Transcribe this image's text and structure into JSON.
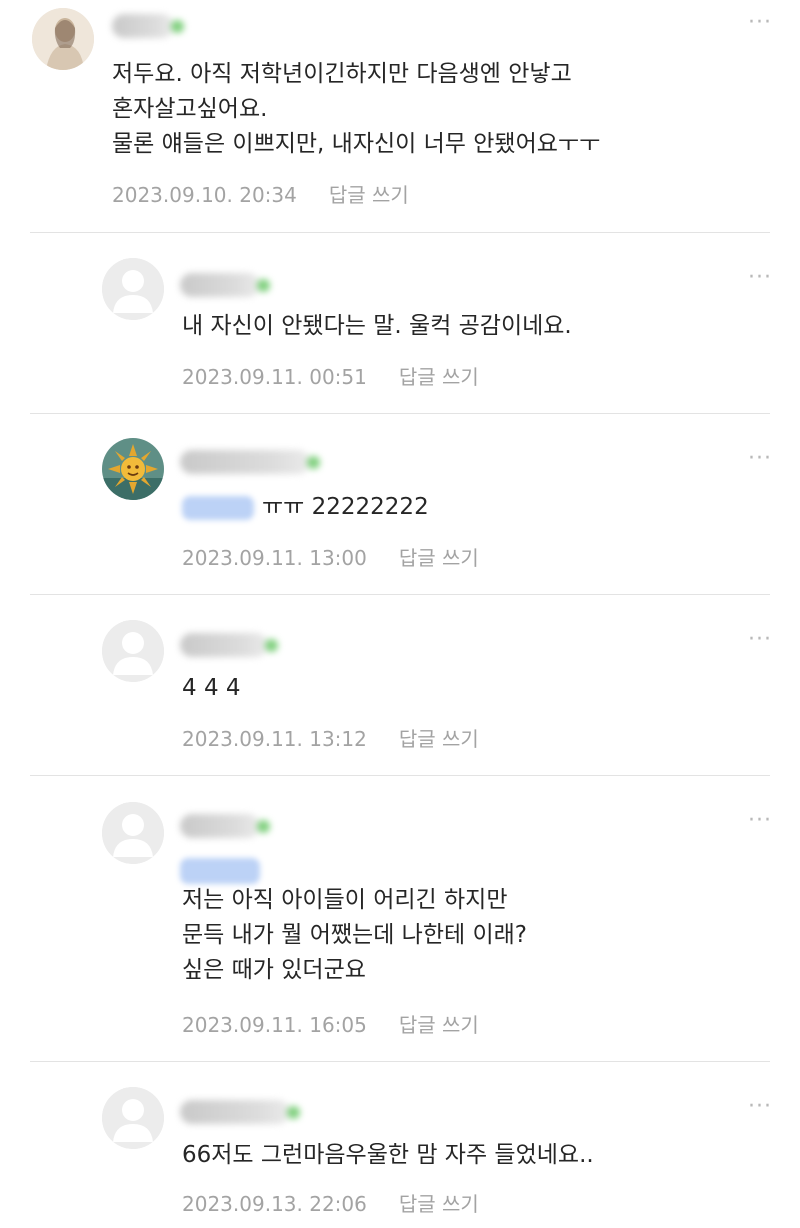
{
  "more_glyph": "···",
  "comments": [
    {
      "text": "저두요. 아직 저학년이긴하지만 다음생엔 안낳고\n혼자살고싶어요.\n물론 얘들은 이쁘지만, 내자신이 너무 안됐어요ㅜㅜ",
      "date": "2023.09.10. 20:34",
      "reply_label": "답글 쓰기",
      "avatar_icon": "profile-photo-icon"
    },
    {
      "text": "내 자신이 안됐다는 말. 울컥 공감이네요.",
      "date": "2023.09.11. 00:51",
      "reply_label": "답글 쓰기",
      "avatar_icon": "default-user-icon"
    },
    {
      "text": "ㅠㅠ 22222222",
      "date": "2023.09.11. 13:00",
      "reply_label": "답글 쓰기",
      "avatar_icon": "sun-avatar-icon"
    },
    {
      "text": "4 4 4",
      "date": "2023.09.11. 13:12",
      "reply_label": "답글 쓰기",
      "avatar_icon": "default-user-icon"
    },
    {
      "text": "저는 아직 아이들이 어리긴 하지만\n문득 내가 뭘 어쨌는데 나한테 이래?\n싶은 때가 있더군요",
      "date": "2023.09.11. 16:05",
      "reply_label": "답글 쓰기",
      "avatar_icon": "default-user-icon"
    },
    {
      "text": "66저도 그런마음우울한 맘 자주 들었네요..",
      "date": "2023.09.13. 22:06",
      "reply_label": "답글 쓰기",
      "avatar_icon": "default-user-icon"
    }
  ]
}
